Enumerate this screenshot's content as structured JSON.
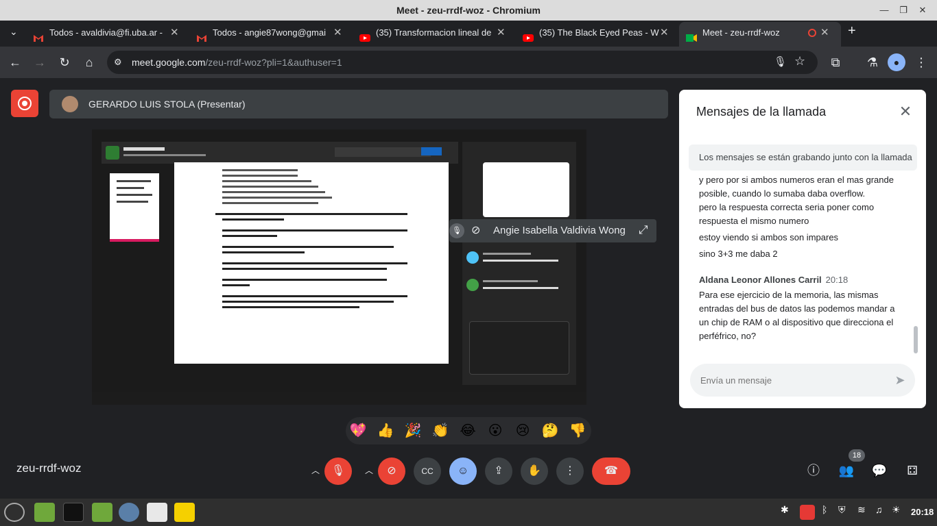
{
  "window": {
    "title": "Meet - zeu-rrdf-woz - Chromium",
    "minimize": "—",
    "maximize": "❐",
    "close": "✕"
  },
  "tabs": [
    {
      "label": "Todos - avaldivia@fi.uba.ar -",
      "icon": "gmail-icon",
      "color": "#ea4335"
    },
    {
      "label": "Todos - angie87wong@gmai",
      "icon": "gmail-icon",
      "color": "#ea4335"
    },
    {
      "label": "(35) Transformacion lineal de",
      "icon": "youtube-icon",
      "color": "#ff0000"
    },
    {
      "label": "(35) The Black Eyed Peas - W",
      "icon": "youtube-icon",
      "color": "#ff0000"
    },
    {
      "label": "Meet - zeu-rrdf-woz",
      "icon": "meet-icon",
      "color": "#00832d",
      "active": true
    }
  ],
  "new_tab": "+",
  "address": {
    "domain": "meet.google.com",
    "path": "/zeu-rrdf-woz?pli=1&authuser=1"
  },
  "presenter": {
    "name": "GERARDO LUIS STOLA (Presentar)"
  },
  "video_tile": {
    "name": "Angie Isabella Valdivia Wong"
  },
  "emojis": [
    "💖",
    "👍",
    "🎉",
    "👏",
    "😂",
    "😮",
    "😢",
    "🤔",
    "👎"
  ],
  "meeting_code": "zeu-rrdf-woz",
  "participants_count": "18",
  "panel": {
    "title": "Mensajes de la llamada",
    "notice": "Los mensajes se están grabando junto con la llamada",
    "messages": [
      {
        "text": "y pero por si ambos numeros eran el mas grande posible, cuando lo sumaba daba overflow."
      },
      {
        "text": "pero la respuesta correcta seria poner como respuesta el mismo numero"
      },
      {
        "text": "estoy viendo si ambos son impares"
      },
      {
        "text": "sino 3+3 me daba 2"
      },
      {
        "sender": "Aldana Leonor Allones Carril",
        "time": "20:18",
        "text": "Para ese ejercicio de la memoria, las mismas entradas del bus de datos las podemos mandar a un chip de RAM o al dispositivo que direcciona el perféfrico, no?"
      }
    ],
    "input_placeholder": "Envía un mensaje"
  },
  "os": {
    "clock": "20:18"
  },
  "colors": {
    "red": "#ea4335",
    "blue": "#8ab4f8",
    "dark": "#202124"
  }
}
